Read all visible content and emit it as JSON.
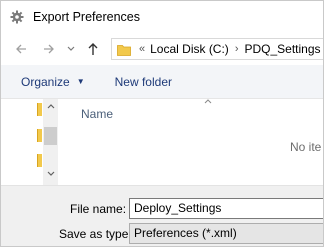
{
  "window": {
    "title": "Export Preferences",
    "title_icon": "gear-icon"
  },
  "navigation": {
    "back_icon": "arrow-left-icon",
    "forward_icon": "arrow-right-icon",
    "history_icon": "chevron-down-icon",
    "up_icon": "arrow-up-icon",
    "address": {
      "overflow": "«",
      "segments": [
        "Local Disk (C:)",
        "PDQ_Settings"
      ],
      "separator": "›"
    }
  },
  "toolbar": {
    "organize_label": "Organize",
    "new_folder_label": "New folder"
  },
  "file_list": {
    "column_name": "Name",
    "empty_message": "No ite"
  },
  "save_form": {
    "file_name_label": "File name:",
    "file_name_value": "Deploy_Settings",
    "save_type_label": "Save as type:",
    "save_type_value": "Preferences (*.xml)"
  },
  "colors": {
    "accent_text": "#1e3a78",
    "folder_yellow": "#f2c94c",
    "toolbar_bg": "#f3f5f8"
  }
}
